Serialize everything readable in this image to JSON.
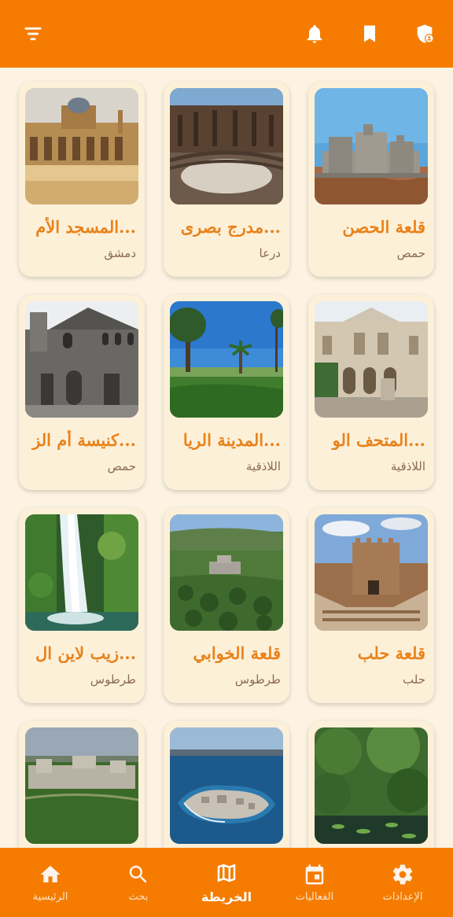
{
  "header": {
    "icons": [
      "filter-icon",
      "bell-icon",
      "bookmark-icon",
      "shield-user-icon"
    ]
  },
  "places": [
    {
      "title": "قلعة الحصن",
      "city": "حمص"
    },
    {
      "title": "...مدرج بصرى",
      "city": "درعا"
    },
    {
      "title": "...المسجد الأم",
      "city": "دمشق"
    },
    {
      "title": "...المتحف الو",
      "city": "اللاذقية"
    },
    {
      "title": "...المدينة الريا",
      "city": "اللاذقية"
    },
    {
      "title": "...كنيسة أم الز",
      "city": "حمص"
    },
    {
      "title": "قلعة حلب",
      "city": "حلب"
    },
    {
      "title": "قلعة الخوابي",
      "city": "طرطوس"
    },
    {
      "title": "...زيب لاين ال",
      "city": "طرطوس"
    },
    {
      "title": "",
      "city": ""
    },
    {
      "title": "",
      "city": ""
    },
    {
      "title": "",
      "city": ""
    }
  ],
  "nav": [
    {
      "label": "الإعدادات",
      "icon": "gear-icon"
    },
    {
      "label": "الفعاليات",
      "icon": "calendar-icon"
    },
    {
      "label": "الخريطة",
      "icon": "map-icon",
      "active": true
    },
    {
      "label": "بحث",
      "icon": "search-icon"
    },
    {
      "label": "الرئيسية",
      "icon": "home-icon"
    }
  ],
  "colors": {
    "primary": "#f57c00",
    "background": "#fdf3e2",
    "title": "#e8821a",
    "city": "#8a6a55"
  }
}
